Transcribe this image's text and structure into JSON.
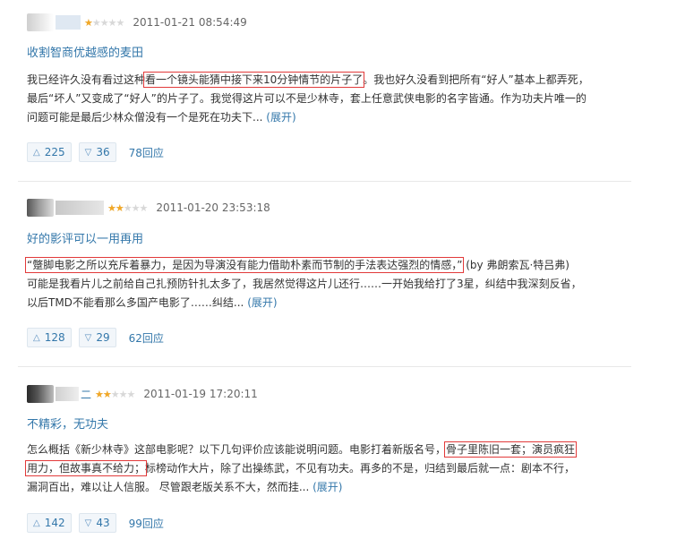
{
  "reviews": [
    {
      "username": "",
      "rating": 1,
      "max_rating": 5,
      "timestamp": "2011-01-21 08:54:49",
      "title": "收割智商优越感的麦田",
      "lines": [
        [
          "我已经许久没有看过这种",
          "看一个镜头能猜中接下来10分钟情节的片子了",
          "。我也好久没看到把所有“好人”基本上都弄死，"
        ],
        [
          "最后“坏人”又变成了“好人”的片子了。我觉得这片可以不是少林寺，套上任意武侠电影的名字皆通。作为功夫片唯一的"
        ],
        [
          "问题可能是最后少林众僧没有一个是死在功夫下... "
        ]
      ],
      "expand": "(展开)",
      "up_votes": "225",
      "down_votes": "36",
      "replies": "78回应"
    },
    {
      "username": "",
      "rating": 2,
      "max_rating": 5,
      "timestamp": "2011-01-20 23:53:18",
      "title": "好的影评可以一用再用",
      "lines": [
        [
          "",
          "“蹩脚电影之所以充斥着暴力，是因为导演没有能力借助朴素而节制的手法表达强烈的情感，”",
          " (by 弗朗索瓦·特吕弗)"
        ],
        [
          "可能是我看片儿之前给自己扎预防针扎太多了，我居然觉得这片儿还行……一开始我给打了3星，纠结中我深刻反省，"
        ],
        [
          "以后TMD不能看那么多国产电影了……纠结... "
        ]
      ],
      "expand": "(展开)",
      "up_votes": "128",
      "down_votes": "29",
      "replies": "62回应"
    },
    {
      "username": "二",
      "rating": 2,
      "max_rating": 5,
      "timestamp": "2011-01-19 17:20:11",
      "title": "不精彩，无功夫",
      "lines": [
        [
          "怎么概括《新少林寺》这部电影呢？以下几句评价应该能说明问题。电影打着新版名号，",
          "骨子里陈旧一套；演员疯狂",
          ""
        ],
        [
          "",
          "用力，但故事真不给力；",
          "标榜动作大片，除了出操练武，不见有功夫。再多的不是，归结到最后就一点：剧本不行，"
        ],
        [
          "漏洞百出，难以让人信服。 尽管跟老版关系不大，然而挂... "
        ]
      ],
      "expand": "(展开)",
      "up_votes": "142",
      "down_votes": "43",
      "replies": "99回应"
    }
  ],
  "icons": {
    "up": "triangle-up-icon",
    "down": "triangle-down-icon",
    "star": "star-icon"
  },
  "colors": {
    "link": "#3377aa",
    "star_on": "#f2a826",
    "star_off": "#d8d8d8",
    "highlight_box": "#e23a3a"
  }
}
